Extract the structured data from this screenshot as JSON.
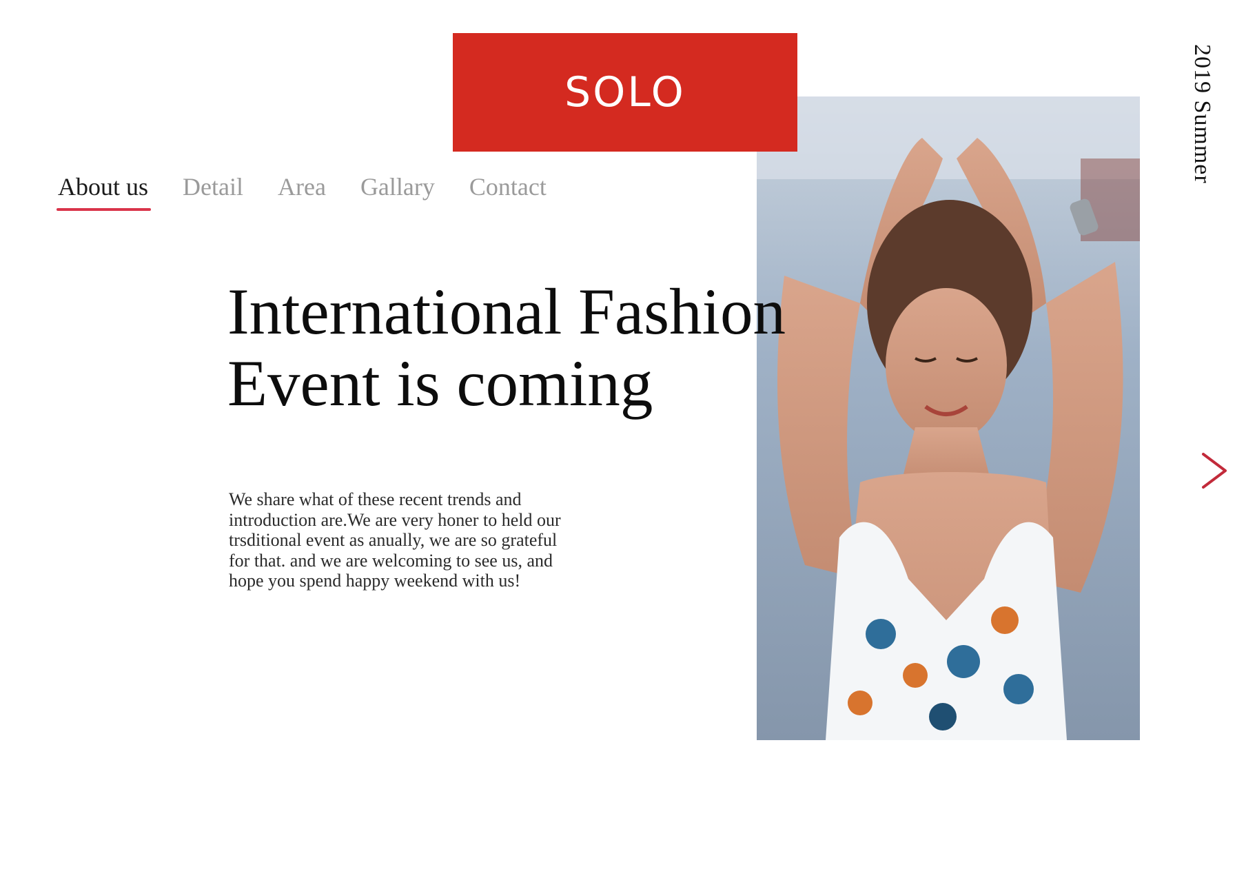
{
  "brand": {
    "logo_text": "SOLO",
    "accent_color": "#d42a20"
  },
  "nav": {
    "items": [
      {
        "label": "About us",
        "active": true
      },
      {
        "label": "Detail",
        "active": false
      },
      {
        "label": "Area",
        "active": false
      },
      {
        "label": "Gallary",
        "active": false
      },
      {
        "label": "Contact",
        "active": false
      }
    ],
    "underline_color": "#d9344a"
  },
  "hero": {
    "headline_line1": "International Fashion",
    "headline_line2": "Event is coming",
    "description": "We share what of these recent trends and introduction are.We are very honer to held our trsditional event as anually, we are so grateful for that. and we are welcoming to see us, and hope you spend happy weekend with us!"
  },
  "side_label": "2019 Summer",
  "icons": {
    "next": "chevron-right-icon"
  }
}
